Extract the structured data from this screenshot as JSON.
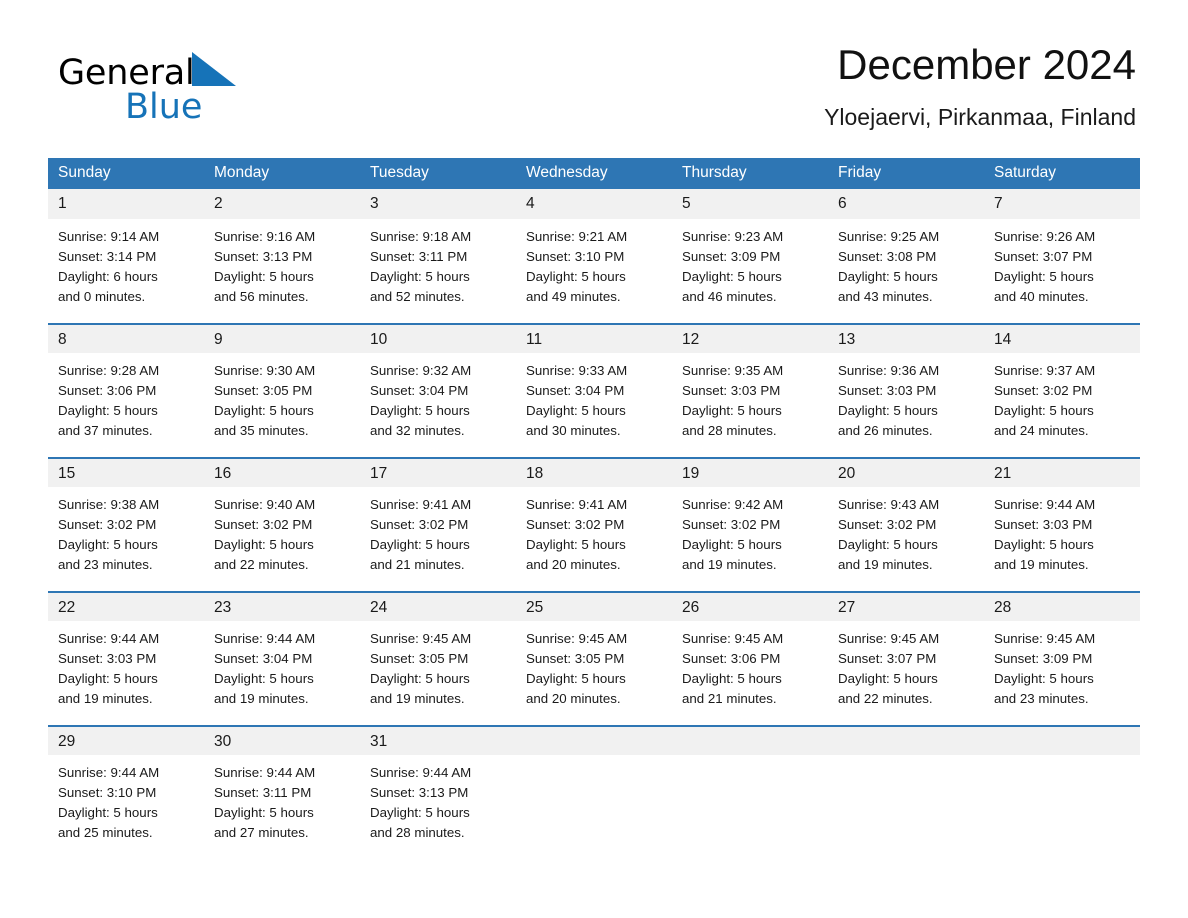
{
  "logo": {
    "word_black": "General",
    "word_blue": "Blue",
    "triangle_color": "#1673B8"
  },
  "header": {
    "title": "December 2024",
    "subtitle": "Yloejaervi, Pirkanmaa, Finland"
  },
  "theme": {
    "header_blue": "#2E76B4",
    "daynum_bg": "#F1F1F1",
    "page_bg": "#FFFFFF"
  },
  "weekday_headers": [
    "Sunday",
    "Monday",
    "Tuesday",
    "Wednesday",
    "Thursday",
    "Friday",
    "Saturday"
  ],
  "weeks": [
    [
      {
        "day": "1",
        "sunrise": "Sunrise: 9:14 AM",
        "sunset": "Sunset: 3:14 PM",
        "daylight1": "Daylight: 6 hours",
        "daylight2": "and 0 minutes."
      },
      {
        "day": "2",
        "sunrise": "Sunrise: 9:16 AM",
        "sunset": "Sunset: 3:13 PM",
        "daylight1": "Daylight: 5 hours",
        "daylight2": "and 56 minutes."
      },
      {
        "day": "3",
        "sunrise": "Sunrise: 9:18 AM",
        "sunset": "Sunset: 3:11 PM",
        "daylight1": "Daylight: 5 hours",
        "daylight2": "and 52 minutes."
      },
      {
        "day": "4",
        "sunrise": "Sunrise: 9:21 AM",
        "sunset": "Sunset: 3:10 PM",
        "daylight1": "Daylight: 5 hours",
        "daylight2": "and 49 minutes."
      },
      {
        "day": "5",
        "sunrise": "Sunrise: 9:23 AM",
        "sunset": "Sunset: 3:09 PM",
        "daylight1": "Daylight: 5 hours",
        "daylight2": "and 46 minutes."
      },
      {
        "day": "6",
        "sunrise": "Sunrise: 9:25 AM",
        "sunset": "Sunset: 3:08 PM",
        "daylight1": "Daylight: 5 hours",
        "daylight2": "and 43 minutes."
      },
      {
        "day": "7",
        "sunrise": "Sunrise: 9:26 AM",
        "sunset": "Sunset: 3:07 PM",
        "daylight1": "Daylight: 5 hours",
        "daylight2": "and 40 minutes."
      }
    ],
    [
      {
        "day": "8",
        "sunrise": "Sunrise: 9:28 AM",
        "sunset": "Sunset: 3:06 PM",
        "daylight1": "Daylight: 5 hours",
        "daylight2": "and 37 minutes."
      },
      {
        "day": "9",
        "sunrise": "Sunrise: 9:30 AM",
        "sunset": "Sunset: 3:05 PM",
        "daylight1": "Daylight: 5 hours",
        "daylight2": "and 35 minutes."
      },
      {
        "day": "10",
        "sunrise": "Sunrise: 9:32 AM",
        "sunset": "Sunset: 3:04 PM",
        "daylight1": "Daylight: 5 hours",
        "daylight2": "and 32 minutes."
      },
      {
        "day": "11",
        "sunrise": "Sunrise: 9:33 AM",
        "sunset": "Sunset: 3:04 PM",
        "daylight1": "Daylight: 5 hours",
        "daylight2": "and 30 minutes."
      },
      {
        "day": "12",
        "sunrise": "Sunrise: 9:35 AM",
        "sunset": "Sunset: 3:03 PM",
        "daylight1": "Daylight: 5 hours",
        "daylight2": "and 28 minutes."
      },
      {
        "day": "13",
        "sunrise": "Sunrise: 9:36 AM",
        "sunset": "Sunset: 3:03 PM",
        "daylight1": "Daylight: 5 hours",
        "daylight2": "and 26 minutes."
      },
      {
        "day": "14",
        "sunrise": "Sunrise: 9:37 AM",
        "sunset": "Sunset: 3:02 PM",
        "daylight1": "Daylight: 5 hours",
        "daylight2": "and 24 minutes."
      }
    ],
    [
      {
        "day": "15",
        "sunrise": "Sunrise: 9:38 AM",
        "sunset": "Sunset: 3:02 PM",
        "daylight1": "Daylight: 5 hours",
        "daylight2": "and 23 minutes."
      },
      {
        "day": "16",
        "sunrise": "Sunrise: 9:40 AM",
        "sunset": "Sunset: 3:02 PM",
        "daylight1": "Daylight: 5 hours",
        "daylight2": "and 22 minutes."
      },
      {
        "day": "17",
        "sunrise": "Sunrise: 9:41 AM",
        "sunset": "Sunset: 3:02 PM",
        "daylight1": "Daylight: 5 hours",
        "daylight2": "and 21 minutes."
      },
      {
        "day": "18",
        "sunrise": "Sunrise: 9:41 AM",
        "sunset": "Sunset: 3:02 PM",
        "daylight1": "Daylight: 5 hours",
        "daylight2": "and 20 minutes."
      },
      {
        "day": "19",
        "sunrise": "Sunrise: 9:42 AM",
        "sunset": "Sunset: 3:02 PM",
        "daylight1": "Daylight: 5 hours",
        "daylight2": "and 19 minutes."
      },
      {
        "day": "20",
        "sunrise": "Sunrise: 9:43 AM",
        "sunset": "Sunset: 3:02 PM",
        "daylight1": "Daylight: 5 hours",
        "daylight2": "and 19 minutes."
      },
      {
        "day": "21",
        "sunrise": "Sunrise: 9:44 AM",
        "sunset": "Sunset: 3:03 PM",
        "daylight1": "Daylight: 5 hours",
        "daylight2": "and 19 minutes."
      }
    ],
    [
      {
        "day": "22",
        "sunrise": "Sunrise: 9:44 AM",
        "sunset": "Sunset: 3:03 PM",
        "daylight1": "Daylight: 5 hours",
        "daylight2": "and 19 minutes."
      },
      {
        "day": "23",
        "sunrise": "Sunrise: 9:44 AM",
        "sunset": "Sunset: 3:04 PM",
        "daylight1": "Daylight: 5 hours",
        "daylight2": "and 19 minutes."
      },
      {
        "day": "24",
        "sunrise": "Sunrise: 9:45 AM",
        "sunset": "Sunset: 3:05 PM",
        "daylight1": "Daylight: 5 hours",
        "daylight2": "and 19 minutes."
      },
      {
        "day": "25",
        "sunrise": "Sunrise: 9:45 AM",
        "sunset": "Sunset: 3:05 PM",
        "daylight1": "Daylight: 5 hours",
        "daylight2": "and 20 minutes."
      },
      {
        "day": "26",
        "sunrise": "Sunrise: 9:45 AM",
        "sunset": "Sunset: 3:06 PM",
        "daylight1": "Daylight: 5 hours",
        "daylight2": "and 21 minutes."
      },
      {
        "day": "27",
        "sunrise": "Sunrise: 9:45 AM",
        "sunset": "Sunset: 3:07 PM",
        "daylight1": "Daylight: 5 hours",
        "daylight2": "and 22 minutes."
      },
      {
        "day": "28",
        "sunrise": "Sunrise: 9:45 AM",
        "sunset": "Sunset: 3:09 PM",
        "daylight1": "Daylight: 5 hours",
        "daylight2": "and 23 minutes."
      }
    ],
    [
      {
        "day": "29",
        "sunrise": "Sunrise: 9:44 AM",
        "sunset": "Sunset: 3:10 PM",
        "daylight1": "Daylight: 5 hours",
        "daylight2": "and 25 minutes."
      },
      {
        "day": "30",
        "sunrise": "Sunrise: 9:44 AM",
        "sunset": "Sunset: 3:11 PM",
        "daylight1": "Daylight: 5 hours",
        "daylight2": "and 27 minutes."
      },
      {
        "day": "31",
        "sunrise": "Sunrise: 9:44 AM",
        "sunset": "Sunset: 3:13 PM",
        "daylight1": "Daylight: 5 hours",
        "daylight2": "and 28 minutes."
      },
      {
        "day": "",
        "sunrise": "",
        "sunset": "",
        "daylight1": "",
        "daylight2": ""
      },
      {
        "day": "",
        "sunrise": "",
        "sunset": "",
        "daylight1": "",
        "daylight2": ""
      },
      {
        "day": "",
        "sunrise": "",
        "sunset": "",
        "daylight1": "",
        "daylight2": ""
      },
      {
        "day": "",
        "sunrise": "",
        "sunset": "",
        "daylight1": "",
        "daylight2": ""
      }
    ]
  ]
}
